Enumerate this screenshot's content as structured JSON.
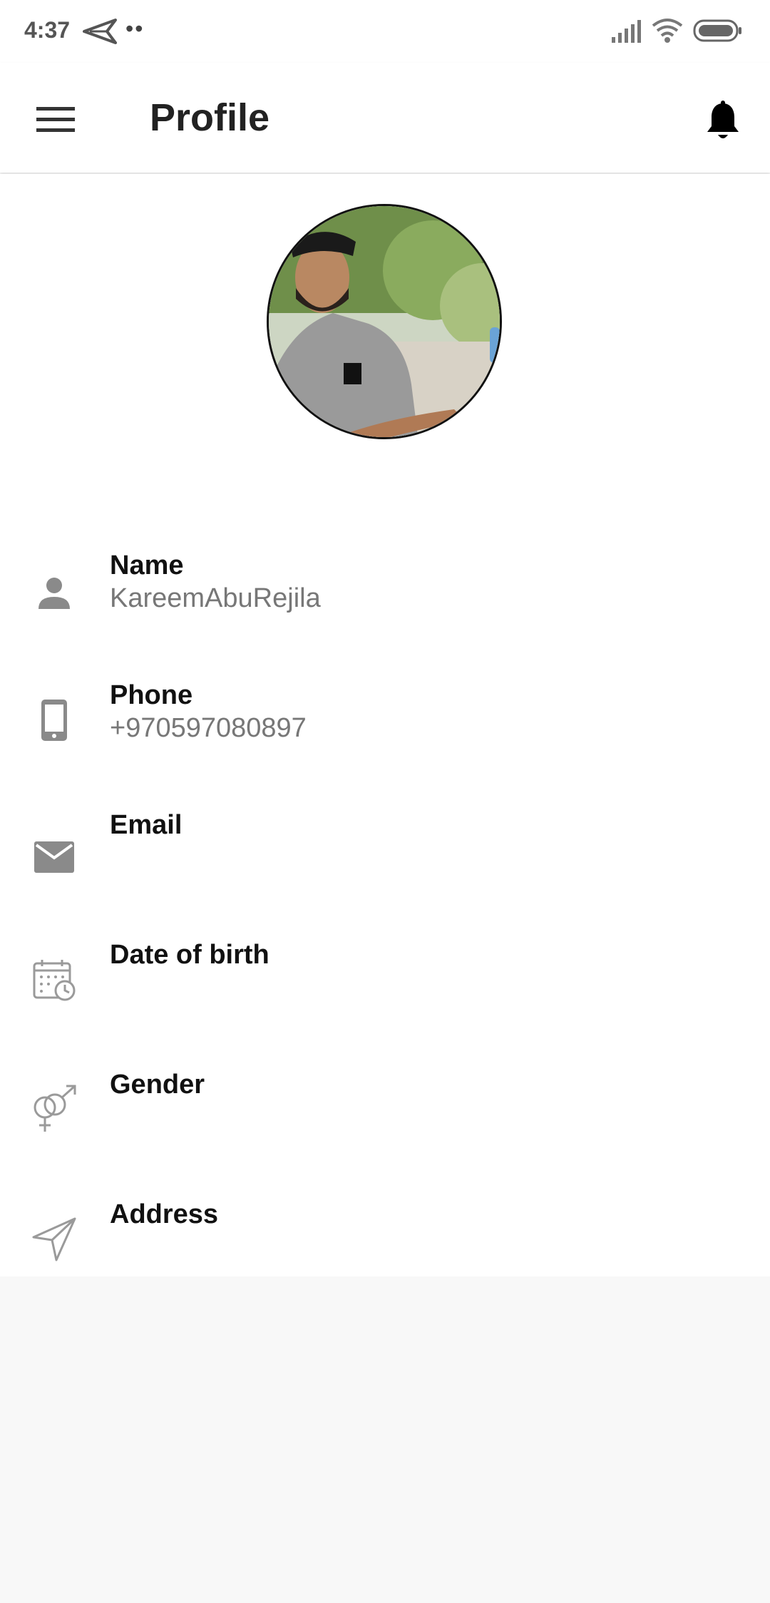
{
  "status_bar": {
    "time": "4:37",
    "dots": "••",
    "icons": [
      "send-icon",
      "signal-icon",
      "wifi-icon",
      "battery-icon"
    ]
  },
  "app_bar": {
    "title": "Profile",
    "menu_icon": "hamburger-menu-icon",
    "bell_icon": "bell-icon"
  },
  "fields": [
    {
      "label": "Name",
      "value": "KareemAbuRejila",
      "icon": "person-icon"
    },
    {
      "label": "Phone",
      "value": "+970597080897",
      "icon": "phone-icon"
    },
    {
      "label": "Email",
      "value": "",
      "icon": "mail-icon"
    },
    {
      "label": "Date of birth",
      "value": "",
      "icon": "calendar-icon"
    },
    {
      "label": "Gender",
      "value": "",
      "icon": "gender-icon"
    },
    {
      "label": "Address",
      "value": "",
      "icon": "location-arrow-icon"
    }
  ],
  "colors": {
    "icon_gray": "#8a8a8a",
    "label": "#111111",
    "value": "#777777",
    "background": "#f8f8f8"
  }
}
